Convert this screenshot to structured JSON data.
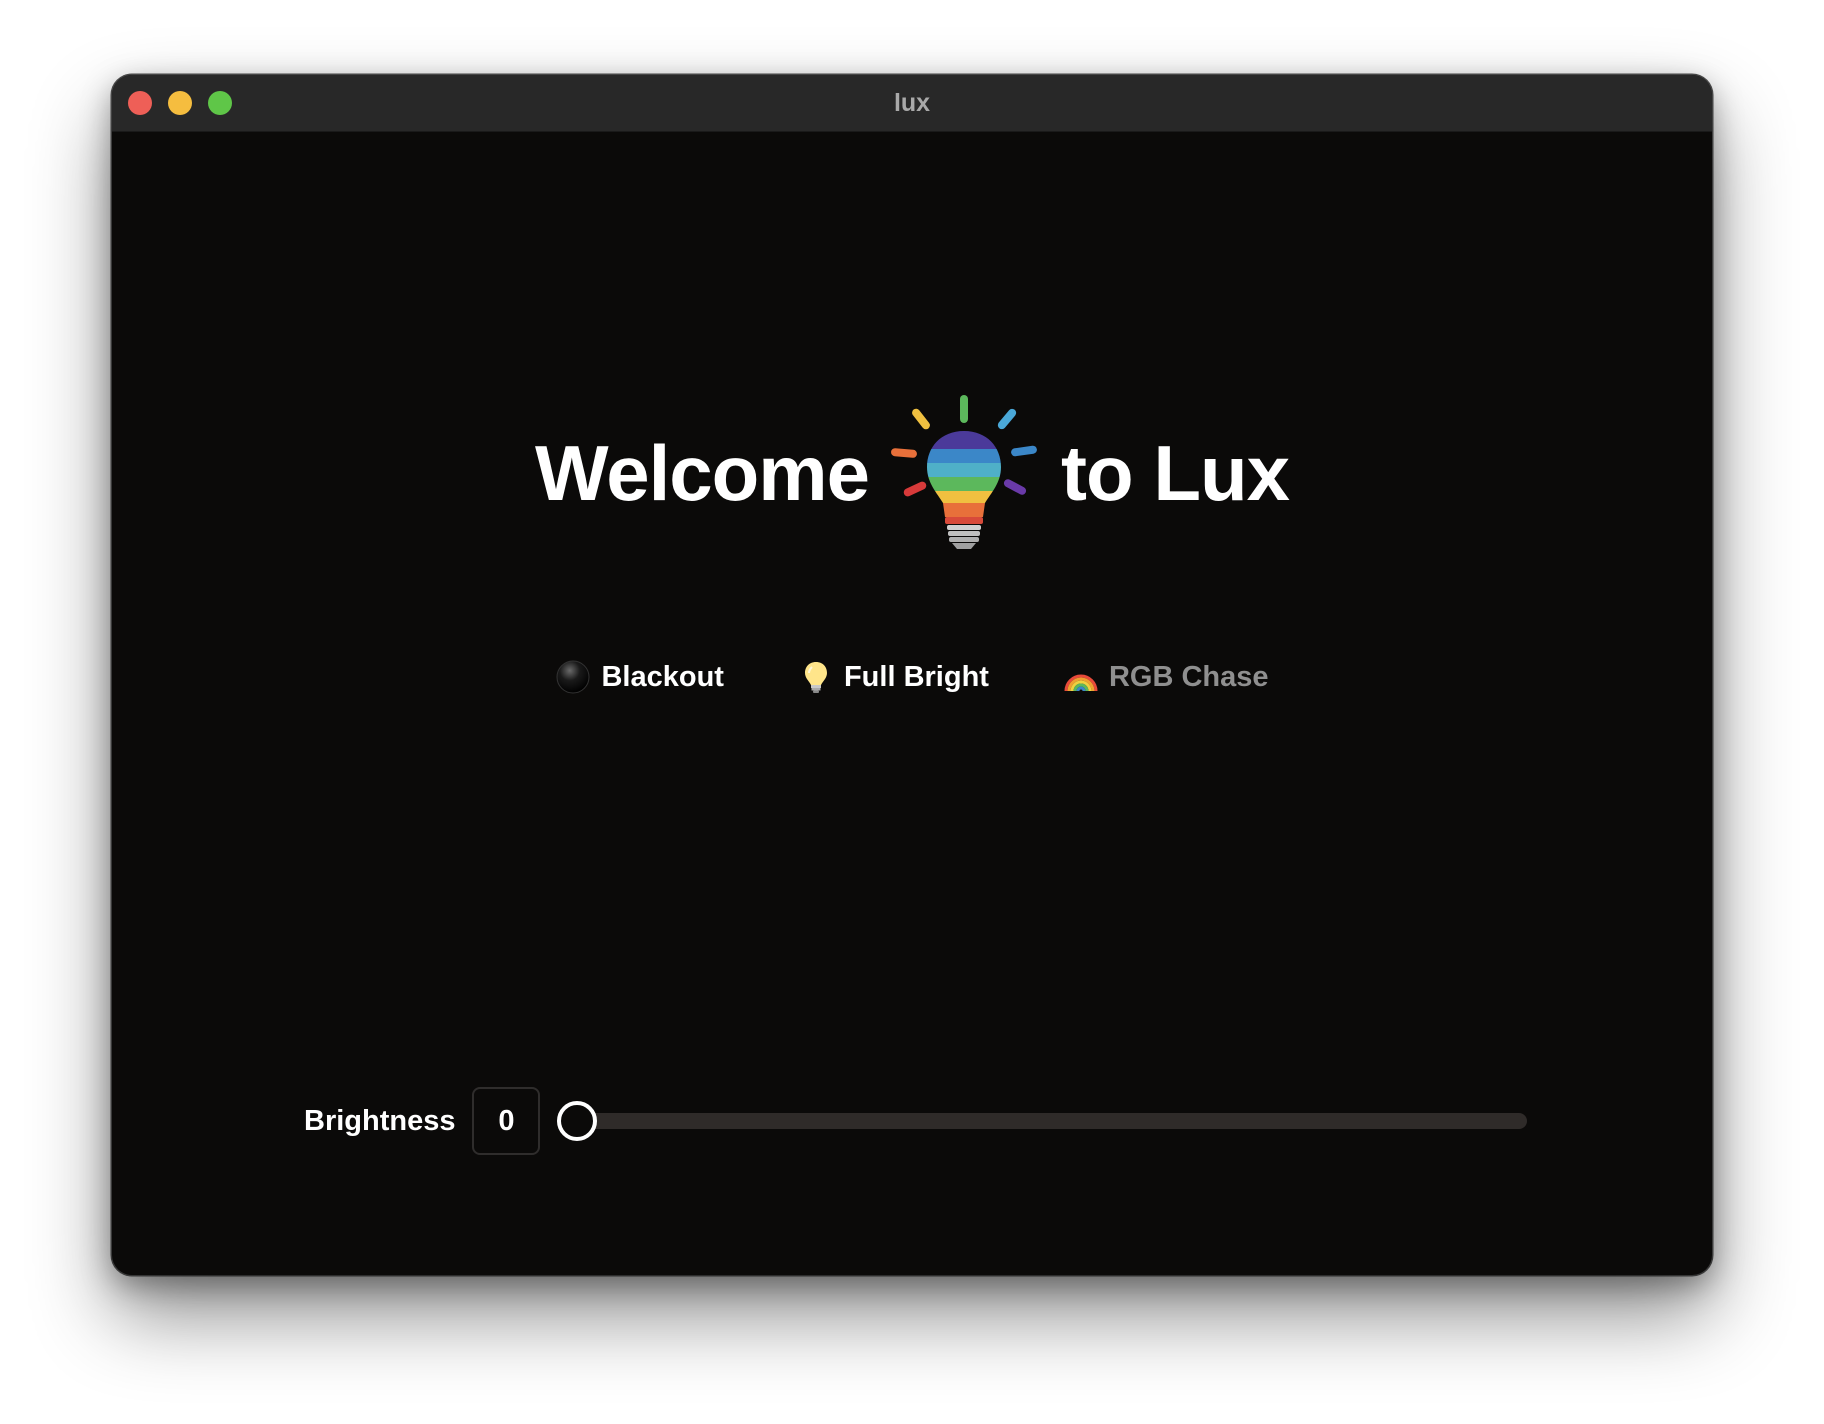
{
  "window": {
    "title": "lux"
  },
  "welcome": {
    "before": "Welcome",
    "after": "to Lux",
    "logo_icon": "rainbow-lightbulb-icon"
  },
  "actions": [
    {
      "label": "Blackout",
      "icon": "black-circle-icon",
      "enabled": true
    },
    {
      "label": "Full Bright",
      "icon": "lightbulb-icon",
      "enabled": true
    },
    {
      "label": "RGB Chase",
      "icon": "rainbow-icon",
      "enabled": false
    }
  ],
  "brightness": {
    "label": "Brightness",
    "value": "0",
    "level": 0
  },
  "colors": {
    "background": "#0b0a09",
    "titlebar": "#282828",
    "text": "#ffffff",
    "disabled_text": "#8f8f8f",
    "track": "#2f2b29"
  }
}
